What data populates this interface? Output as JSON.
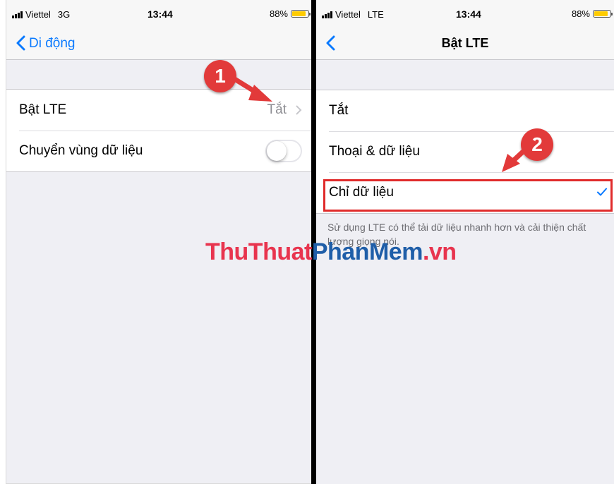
{
  "left_screen": {
    "status": {
      "carrier": "Viettel",
      "network": "3G",
      "time": "13:44",
      "battery": "88%"
    },
    "nav": {
      "back_label": "Di động"
    },
    "rows": [
      {
        "label": "Bật LTE",
        "value": "Tắt"
      },
      {
        "label": "Chuyển vùng dữ liệu",
        "toggle": false
      }
    ]
  },
  "right_screen": {
    "status": {
      "carrier": "Viettel",
      "network": "LTE",
      "time": "13:44",
      "battery": "88%"
    },
    "nav": {
      "title": "Bật LTE"
    },
    "options": [
      {
        "label": "Tắt"
      },
      {
        "label": "Thoại & dữ liệu"
      },
      {
        "label": "Chỉ dữ liệu",
        "selected": true
      }
    ],
    "footer": "Sử dụng LTE có thể tải dữ liệu nhanh hơn và cải thiện chất lượng giọng nói."
  },
  "annotations": {
    "step1": "1",
    "step2": "2"
  },
  "watermark": {
    "part1": "ThuThuat",
    "part2": "PhanMem",
    "part3": ".vn"
  },
  "colors": {
    "accent": "#0a7aff",
    "annotation": "#e23a3a",
    "battery": "#ffcc00"
  }
}
